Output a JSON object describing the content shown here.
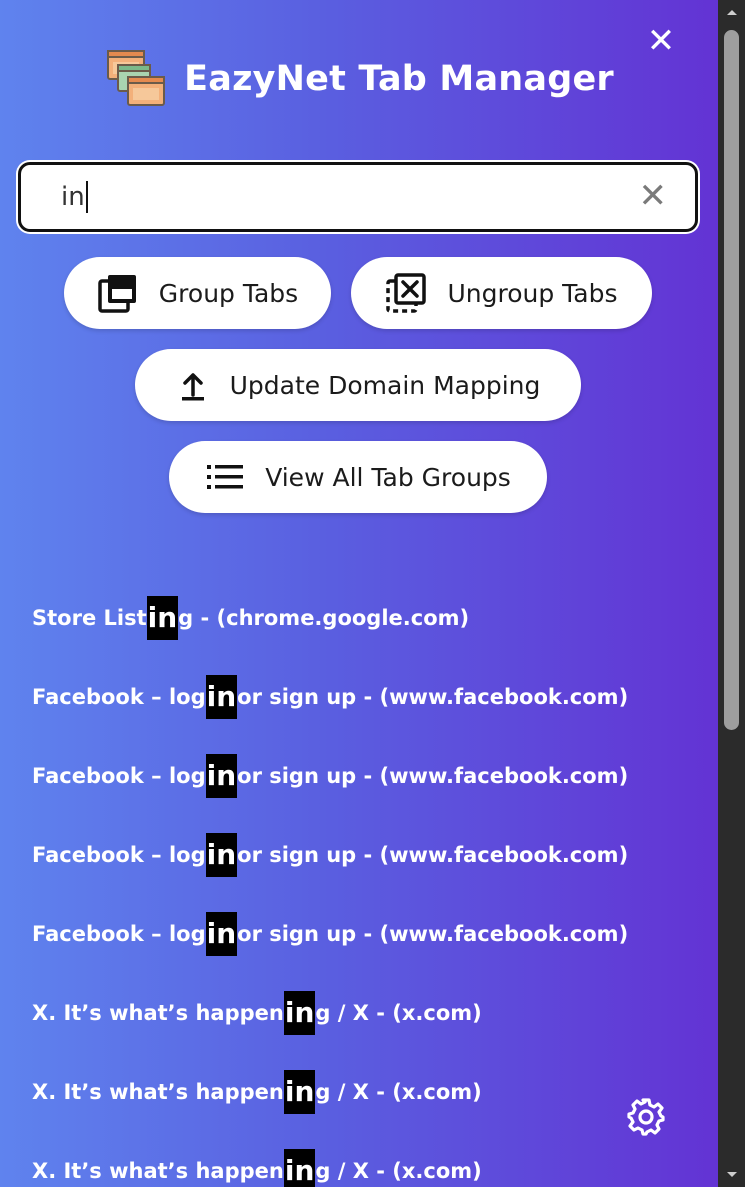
{
  "window": {
    "close_label": "✕"
  },
  "header": {
    "title": "EazyNet Tab Manager",
    "logo_icon": "browser-windows-logo"
  },
  "search": {
    "value": "in",
    "clear_label": "✕"
  },
  "actions": {
    "group_tabs": "Group Tabs",
    "ungroup_tabs": "Ungroup Tabs",
    "update_domain_mapping": "Update Domain Mapping",
    "view_all_tab_groups": "View All Tab Groups"
  },
  "results": [
    {
      "before": "Store List",
      "match": "in",
      "after": "g - (chrome.google.com)"
    },
    {
      "before": "Facebook – log ",
      "match": "in",
      "after": " or sign up - (www.facebook.com)"
    },
    {
      "before": "Facebook – log ",
      "match": "in",
      "after": " or sign up - (www.facebook.com)"
    },
    {
      "before": "Facebook – log ",
      "match": "in",
      "after": " or sign up - (www.facebook.com)"
    },
    {
      "before": "Facebook – log ",
      "match": "in",
      "after": " or sign up - (www.facebook.com)"
    },
    {
      "before": "X. It’s what’s happen",
      "match": "in",
      "after": "g / X - (x.com)"
    },
    {
      "before": "X. It’s what’s happen",
      "match": "in",
      "after": "g / X - (x.com)"
    },
    {
      "before": "X. It’s what’s happen",
      "match": "in",
      "after": "g / X - (x.com)"
    }
  ],
  "colors": {
    "gradient_start": "#5f83ee",
    "gradient_end": "#6333d4",
    "highlight_bg": "#000000",
    "button_bg": "#ffffff"
  }
}
